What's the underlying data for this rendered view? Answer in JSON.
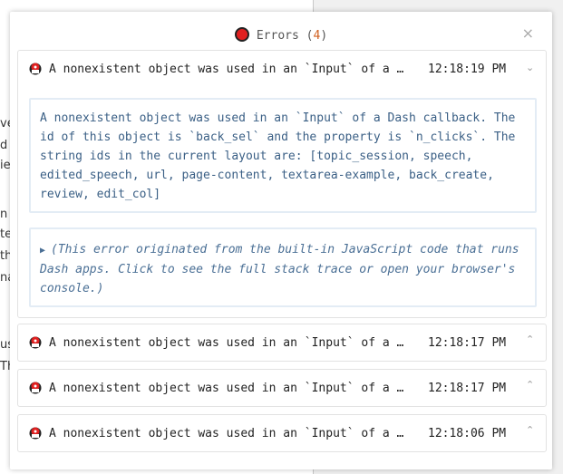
{
  "background": {
    "lines": [
      "ve",
      "d",
      "ie",
      "",
      "n",
      "te",
      "th",
      "na",
      "",
      "",
      "us",
      "Th"
    ]
  },
  "header": {
    "title": "Errors",
    "count": "4",
    "close_label": "×"
  },
  "errors": [
    {
      "summary": "A nonexistent object was used in an `Input` of a …",
      "time": "12:18:19 PM",
      "expanded": true,
      "detail": "A nonexistent object was used in an `Input` of a Dash callback. The id of this object is `back_sel` and the property is `n_clicks`. The string ids in the current layout are: [topic_session, speech, edited_speech, url, page-content, textarea-example, back_create, review, edit_col]",
      "stack": "(This error originated from the built-in JavaScript code that runs Dash apps. Click to see the full stack trace or open your browser's console.)"
    },
    {
      "summary": "A nonexistent object was used in an `Input` of a …",
      "time": "12:18:17 PM",
      "expanded": false
    },
    {
      "summary": "A nonexistent object was used in an `Input` of a …",
      "time": "12:18:17 PM",
      "expanded": false
    },
    {
      "summary": "A nonexistent object was used in an `Input` of a …",
      "time": "12:18:06 PM",
      "expanded": false
    }
  ],
  "icons": {
    "error_dot": "error-circle-icon",
    "bug": "bug-icon",
    "close": "close-icon",
    "chevron_down": "chevron-down-icon",
    "chevron_up": "chevron-up-icon",
    "triangle": "triangle-right-icon"
  },
  "colors": {
    "error_red": "#e02020",
    "count_orange": "#d06020",
    "detail_text": "#3a5f85",
    "detail_border": "#e3ecf5"
  }
}
